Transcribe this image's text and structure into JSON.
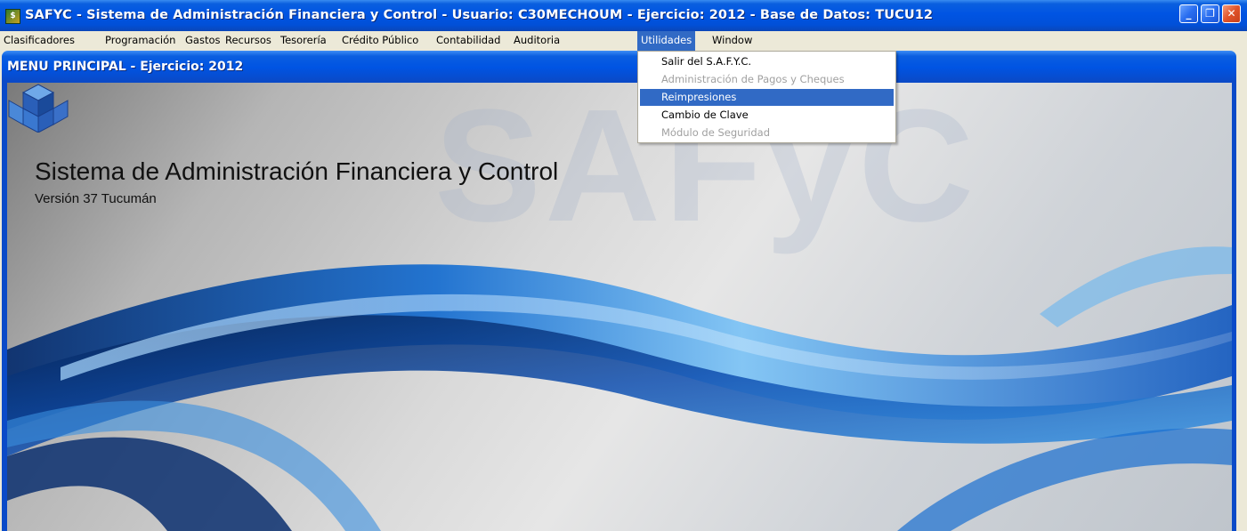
{
  "window": {
    "title": "SAFYC - Sistema de Administración Financiera y Control    - Usuario: C30MECHOUM - Ejercicio: 2012 - Base de Datos: TUCU12",
    "icon": "safyc-app-icon",
    "controls": {
      "minimize": "_",
      "maximize": "❐",
      "close": "✕"
    }
  },
  "menubar": {
    "items": [
      {
        "label": "Clasificadores"
      },
      {
        "label": "Programación"
      },
      {
        "label": "Gastos"
      },
      {
        "label": "Recursos"
      },
      {
        "label": "Tesorería"
      },
      {
        "label": "Crédito Público"
      },
      {
        "label": "Contabilidad"
      },
      {
        "label": "Auditoria"
      },
      {
        "label": "Utilidades"
      },
      {
        "label": "Window"
      }
    ],
    "active": "Utilidades"
  },
  "dropdown": {
    "items": [
      {
        "label": "Salir del S.A.F.Y.C.",
        "state": "enabled"
      },
      {
        "label": "Administración de Pagos y Cheques",
        "state": "disabled"
      },
      {
        "label": "Reimpresiones",
        "state": "highlighted"
      },
      {
        "label": "Cambio de Clave",
        "state": "enabled"
      },
      {
        "label": "Módulo de Seguridad",
        "state": "disabled"
      }
    ]
  },
  "child_window": {
    "title": "MENU PRINCIPAL - Ejercicio: 2012"
  },
  "splash": {
    "heading": "Sistema de Administración Financiera y Control",
    "version": "Versión 37 Tucumán",
    "watermark": "SAFyC"
  },
  "colors": {
    "titlebar_blue": "#0054e3",
    "menu_highlight": "#316ac5",
    "close_button": "#e0532a",
    "menubar_bg": "#ece9d8"
  }
}
